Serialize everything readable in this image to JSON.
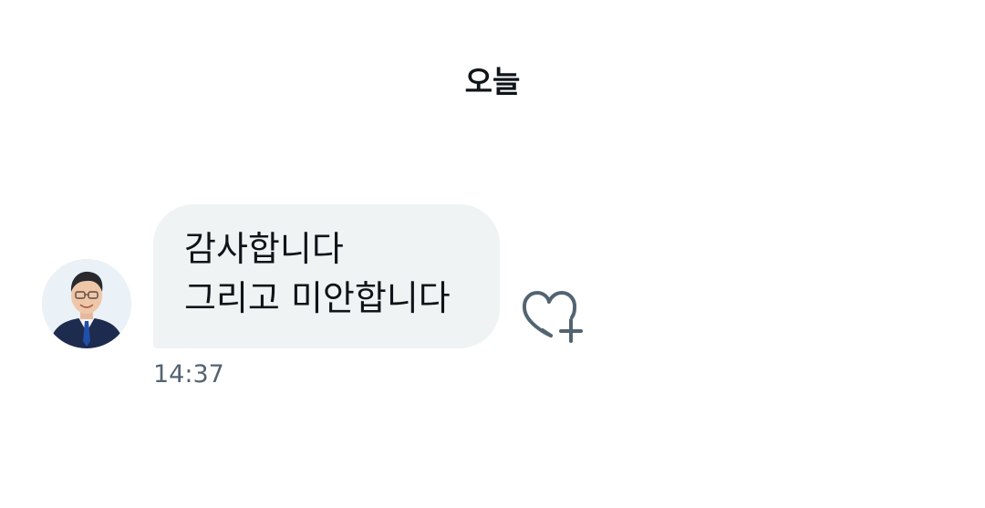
{
  "conversation": {
    "date_divider": "오늘",
    "message": {
      "lines": [
        "감사합니다",
        "그리고 미안합니다"
      ],
      "timestamp": "14:37",
      "sender_avatar": "profile-photo",
      "reaction_icon": "heart-plus-icon"
    }
  },
  "colors": {
    "bubble_background": "#eff3f4",
    "text_primary": "#0f1419",
    "text_secondary": "#536471",
    "icon": "#536471"
  }
}
